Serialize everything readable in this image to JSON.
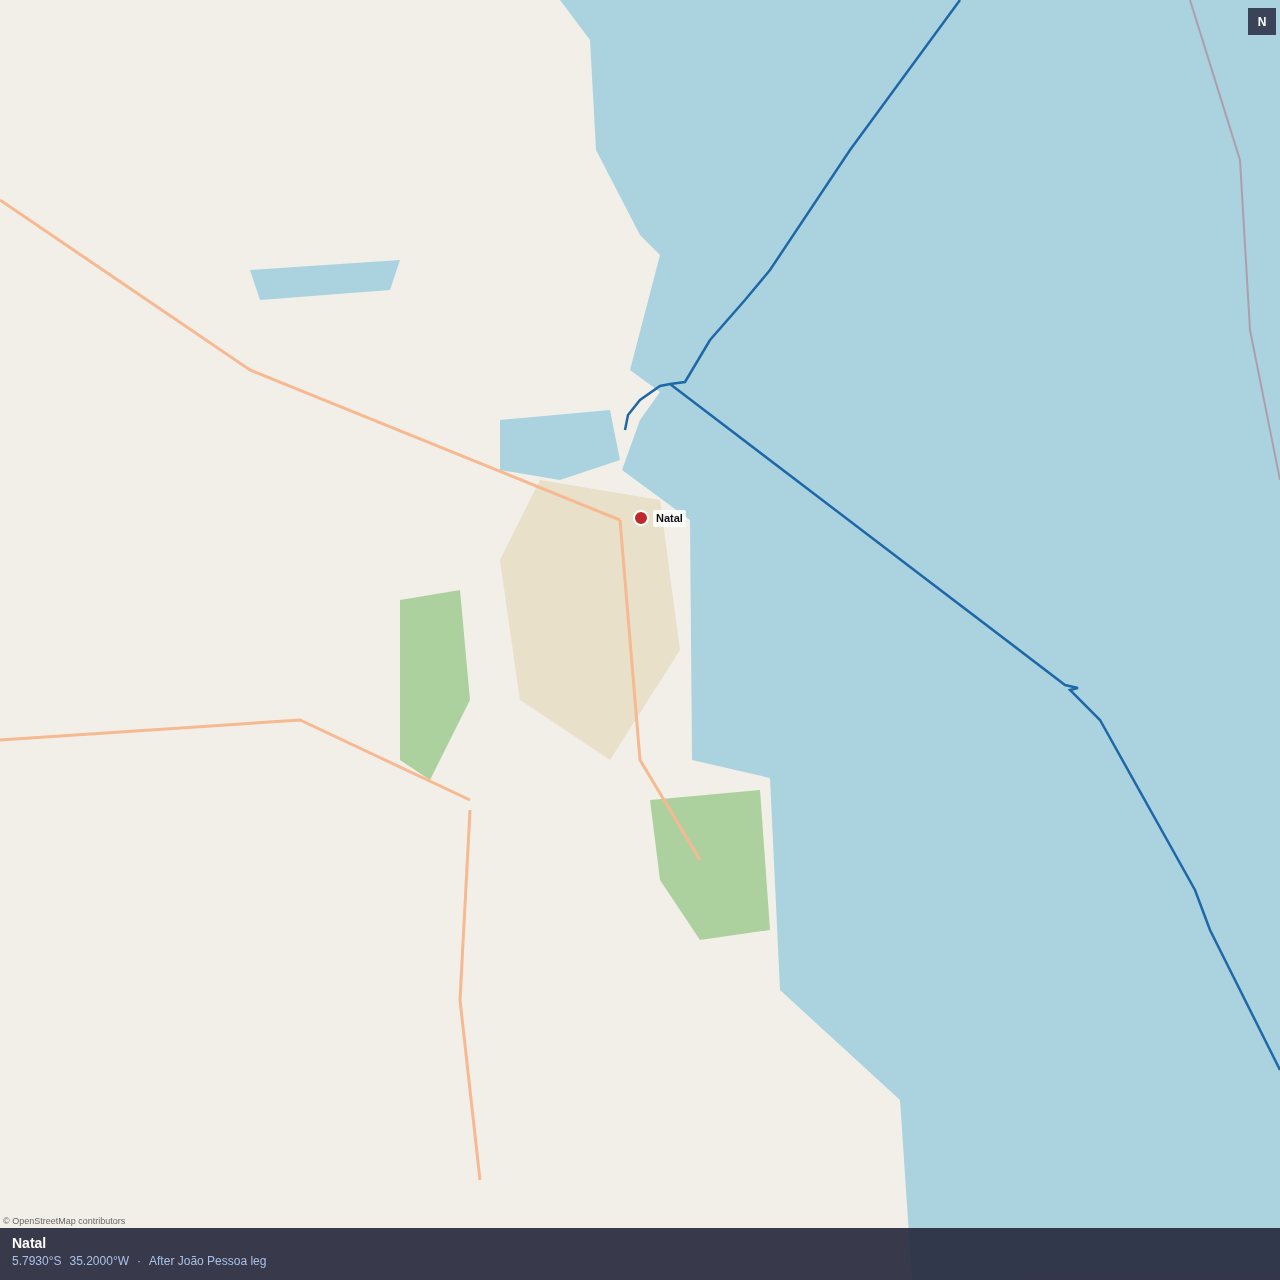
{
  "map": {
    "compass": "N",
    "marker": {
      "label": "Natal"
    },
    "attribution": "© OpenStreetMap contributors"
  },
  "info_bar": {
    "title": "Natal",
    "latitude": "5.7930°S",
    "longitude": "35.2000°W",
    "separator": "·",
    "note": "After João Pessoa leg"
  }
}
